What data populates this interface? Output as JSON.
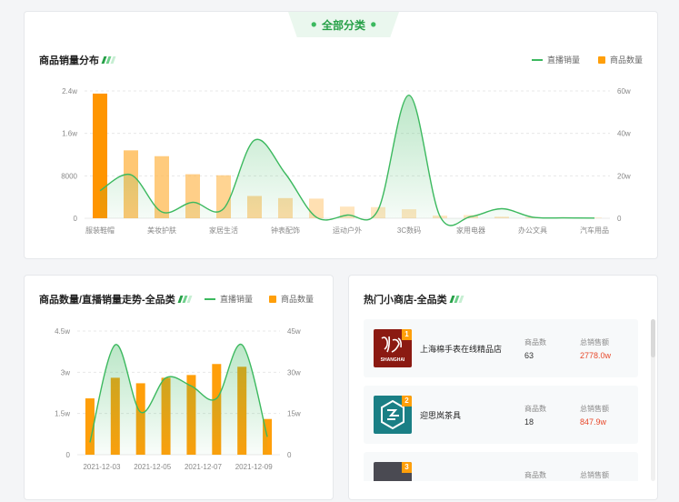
{
  "header": {
    "tab_label": "全部分类",
    "tab_icon": "leaf-icon"
  },
  "colors": {
    "green": "#3cb95f",
    "orange": "#ff9f0a",
    "light_orange": "#ffd591",
    "price_red": "#e8492b"
  },
  "legend": {
    "line_label": "直播销量",
    "bar_label": "商品数量"
  },
  "distribution": {
    "title": "商品销量分布"
  },
  "trend": {
    "title": "商品数量/直播销量走势-全品类"
  },
  "hot_shops": {
    "title": "热门小商店-全品类",
    "count_label": "商品数",
    "sales_label": "总销售额",
    "items": [
      {
        "rank": "1",
        "name": "上海棉手表在线精品店",
        "logo_text": "SHANGHAI",
        "count": "63",
        "sales": "2778.0w"
      },
      {
        "rank": "2",
        "name": "迎思岚茶具",
        "logo_text": "",
        "count": "18",
        "sales": "847.9w"
      },
      {
        "rank": "3",
        "name": "",
        "logo_text": "",
        "count": "",
        "sales": ""
      }
    ]
  },
  "chart_data": [
    {
      "type": "bar",
      "title": "商品销量分布",
      "categories": [
        "服装鞋帽",
        "",
        "美妆护肤",
        "",
        "家居生活",
        "",
        "钟表配饰",
        "",
        "运动户外",
        "",
        "3C数码",
        "",
        "家用电器",
        "",
        "办公文具",
        "",
        "汽车用品"
      ],
      "y_ticks": [
        "0",
        "8000",
        "1.6w",
        "2.4w"
      ],
      "y2_ticks": [
        "0",
        "20w",
        "40w",
        "60w"
      ],
      "ylim": [
        0,
        24000
      ],
      "y2lim": [
        0,
        600000
      ],
      "series": [
        {
          "name": "商品数量",
          "type": "bar",
          "values": [
            23500,
            12800,
            11700,
            8300,
            8100,
            4200,
            3800,
            3700,
            2200,
            2100,
            1700,
            500,
            600,
            300,
            200,
            200,
            100
          ]
        },
        {
          "name": "直播销量",
          "type": "line",
          "values": [
            130000,
            205000,
            30000,
            75000,
            45000,
            368000,
            210000,
            5000,
            15000,
            40000,
            580000,
            10000,
            8000,
            45000,
            5000,
            2000,
            1000
          ]
        }
      ]
    },
    {
      "type": "bar",
      "title": "商品数量/直播销量走势-全品类",
      "categories": [
        "2021-12-03",
        "",
        "2021-12-05",
        "",
        "2021-12-07",
        "",
        "2021-12-09",
        ""
      ],
      "y_ticks": [
        "0",
        "1.5w",
        "3w",
        "4.5w"
      ],
      "y2_ticks": [
        "0",
        "15w",
        "30w",
        "45w"
      ],
      "ylim": [
        0,
        45000
      ],
      "y2lim": [
        0,
        450000
      ],
      "series": [
        {
          "name": "商品数量",
          "type": "bar",
          "values": [
            20500,
            28000,
            26000,
            28000,
            29000,
            33000,
            32000,
            13000
          ]
        },
        {
          "name": "直播销量",
          "type": "line",
          "values": [
            45000,
            400000,
            155000,
            280000,
            250000,
            205000,
            400000,
            65000
          ]
        }
      ]
    }
  ]
}
